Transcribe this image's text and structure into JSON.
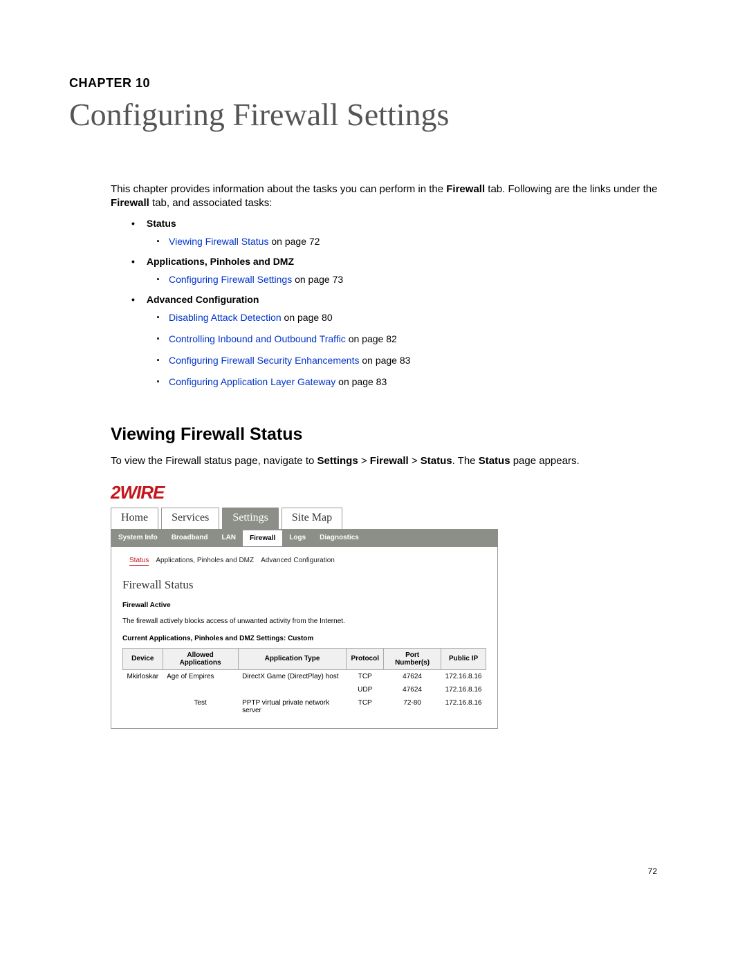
{
  "chapter_label": "CHAPTER 10",
  "chapter_title": "Configuring Firewall Settings",
  "intro_1": "This chapter provides information about the tasks you can perform in the ",
  "intro_b1": "Firewall",
  "intro_2": " tab. Following are the links under the ",
  "intro_b2": "Firewall",
  "intro_3": " tab, and associated tasks:",
  "categories": [
    {
      "name": "Status",
      "items": [
        {
          "link": "Viewing Firewall Status",
          "rest": " on page 72"
        }
      ]
    },
    {
      "name": "Applications, Pinholes and DMZ",
      "items": [
        {
          "link": "Configuring Firewall Settings",
          "rest": " on page 73"
        }
      ]
    },
    {
      "name": "Advanced Configuration",
      "items": [
        {
          "link": "Disabling Attack Detection",
          "rest": " on page 80"
        },
        {
          "link": "Controlling Inbound and Outbound Traffic",
          "rest": " on page 82"
        },
        {
          "link": "Configuring Firewall Security Enhancements",
          "rest": " on page 83"
        },
        {
          "link": "Configuring Application Layer Gateway",
          "rest": " on page 83"
        }
      ]
    }
  ],
  "section_heading": "Viewing Firewall Status",
  "section_body_1": "To view the Firewall status page, navigate to ",
  "section_body_b1": "Settings",
  "section_body_gt1": " > ",
  "section_body_b2": "Firewall",
  "section_body_gt2": " > ",
  "section_body_b3": "Status",
  "section_body_4": ". The ",
  "section_body_b4": "Status",
  "section_body_5": " page appears.",
  "shot": {
    "brand": "2WIRE",
    "main_tabs": [
      "Home",
      "Services",
      "Settings",
      "Site Map"
    ],
    "main_active": "Settings",
    "sub_tabs": [
      "System Info",
      "Broadband",
      "LAN",
      "Firewall",
      "Logs",
      "Diagnostics"
    ],
    "sub_active": "Firewall",
    "subsub": [
      "Status",
      "Applications, Pinholes and DMZ",
      "Advanced Configuration"
    ],
    "subsub_active": "Status",
    "title": "Firewall Status",
    "sub1": "Firewall Active",
    "desc": "The firewall actively blocks access of unwanted activity from the Internet.",
    "sub2": "Current Applications, Pinholes and DMZ Settings: Custom",
    "table": {
      "headers": [
        "Device",
        "Allowed Applications",
        "Application Type",
        "Protocol",
        "Port Number(s)",
        "Public IP"
      ],
      "rows": [
        [
          "Mkirloskar",
          "Age of Empires",
          "DirectX Game (DirectPlay) host",
          "TCP",
          "47624",
          "172.16.8.16"
        ],
        [
          "",
          "",
          "",
          "UDP",
          "47624",
          "172.16.8.16"
        ],
        [
          "",
          "Test",
          "PPTP virtual private network server",
          "TCP",
          "72-80",
          "172.16.8.16"
        ]
      ]
    }
  },
  "page_number": "72"
}
